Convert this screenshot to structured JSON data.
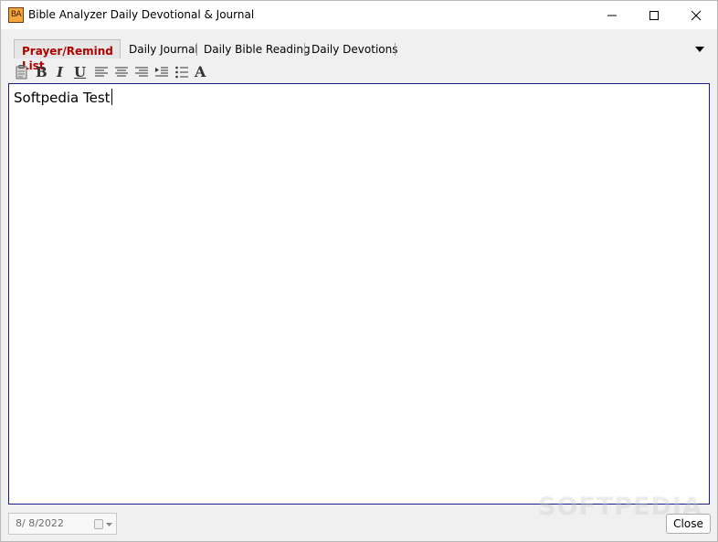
{
  "window": {
    "title": "Bible Analyzer Daily Devotional & Journal",
    "app_icon_text": "BA"
  },
  "tabs": [
    {
      "label": "Prayer/Remind List",
      "active": true
    },
    {
      "label": "Daily Journal",
      "active": false
    },
    {
      "label": "Daily Bible Reading",
      "active": false
    },
    {
      "label": "Daily Devotions",
      "active": false
    }
  ],
  "toolbar": {
    "bold_label": "B",
    "italic_label": "I",
    "underline_label": "U",
    "font_label": "A",
    "icons": [
      "paste-icon",
      "bold-icon",
      "italic-icon",
      "underline-icon",
      "align-left-icon",
      "align-center-icon",
      "align-right-icon",
      "indent-icon",
      "bullet-list-icon",
      "font-icon"
    ]
  },
  "editor": {
    "content": "Softpedia Test"
  },
  "footer": {
    "date_value": "8/  8/2022",
    "close_label": "Close",
    "watermark": "SOFTPEDIA"
  },
  "colors": {
    "active_tab_text": "#b00000",
    "editor_border": "#1c1c8c",
    "window_bg": "#f0f0f0"
  }
}
